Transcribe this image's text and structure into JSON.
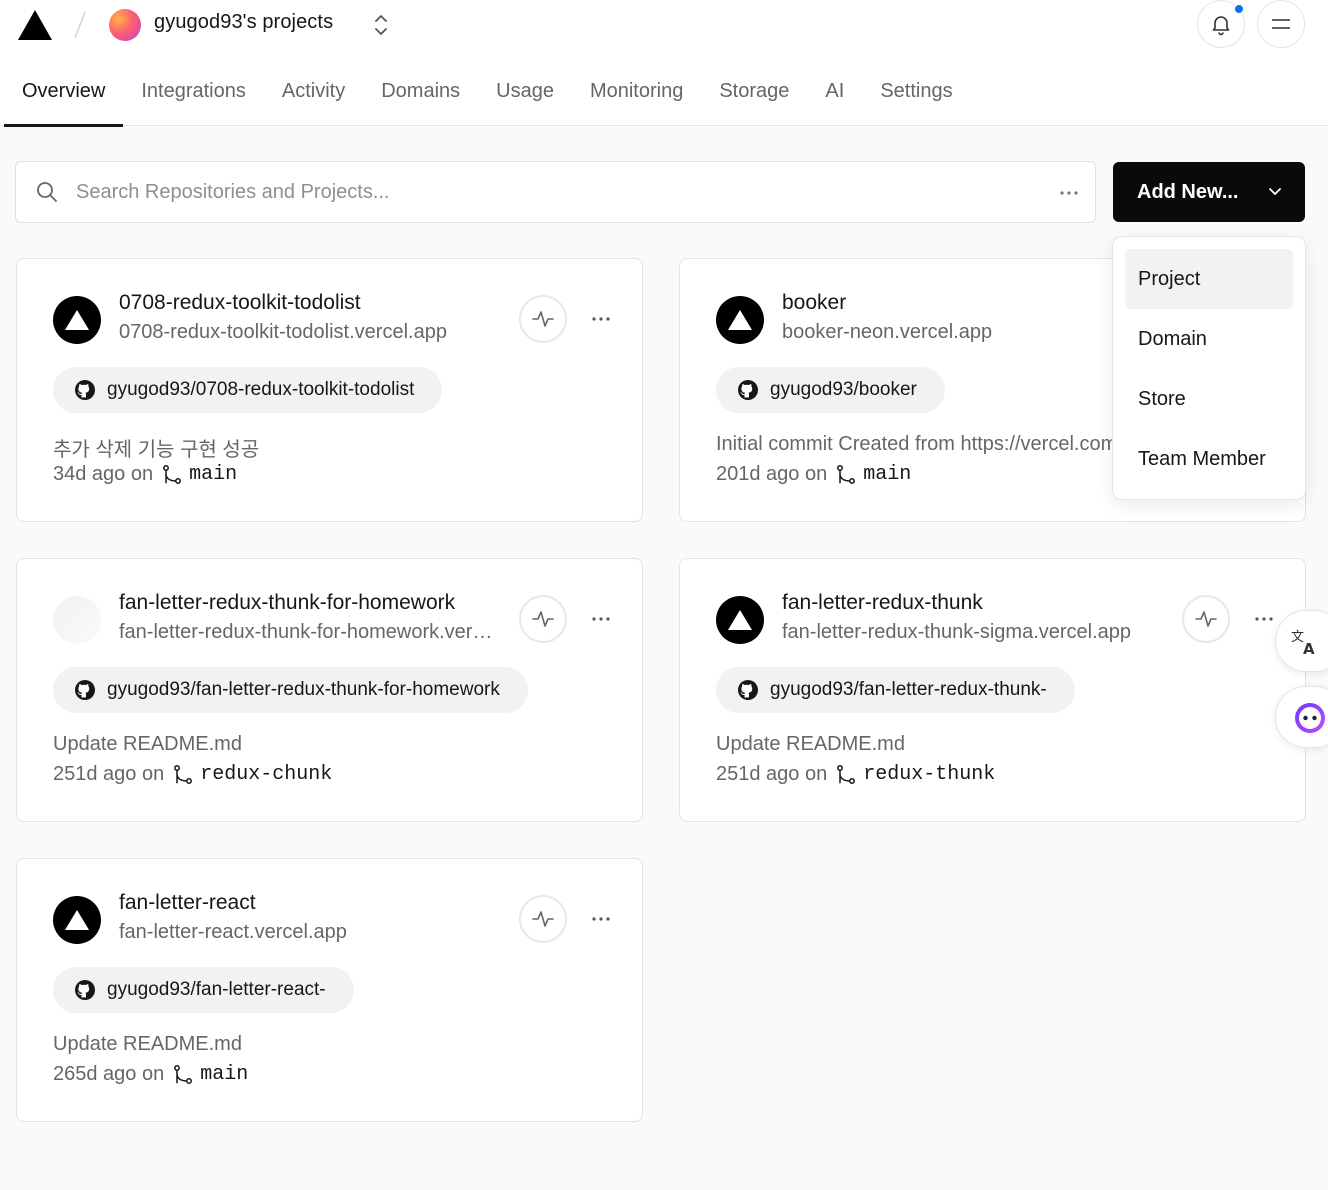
{
  "header": {
    "team_name": "gyugod93's projects",
    "colors": {
      "notification_dot": "#0a72ef",
      "primary_button": "#0a0a0a"
    }
  },
  "tabs": [
    {
      "label": "Overview",
      "active": true
    },
    {
      "label": "Integrations",
      "active": false
    },
    {
      "label": "Activity",
      "active": false
    },
    {
      "label": "Domains",
      "active": false
    },
    {
      "label": "Usage",
      "active": false
    },
    {
      "label": "Monitoring",
      "active": false
    },
    {
      "label": "Storage",
      "active": false
    },
    {
      "label": "AI",
      "active": false
    },
    {
      "label": "Settings",
      "active": false
    }
  ],
  "search": {
    "placeholder": "Search Repositories and Projects...",
    "value": ""
  },
  "add_new": {
    "label": "Add New...",
    "menu": [
      "Project",
      "Domain",
      "Store",
      "Team Member"
    ],
    "highlighted": "Project"
  },
  "projects": [
    {
      "name": "0708-redux-toolkit-todolist",
      "url": "0708-redux-toolkit-todolist.vercel.app",
      "repo": "gyugod93/0708-redux-toolkit-todolist",
      "commit": "추가 삭제 기능 구현 성공",
      "age": "34d ago on",
      "branch": "main",
      "avatar": "vercel-triangle"
    },
    {
      "name": "booker",
      "url": "booker-neon.vercel.app",
      "repo": "gyugod93/booker",
      "commit": "Initial commit Created from https://vercel.com/new",
      "age": "201d ago on",
      "branch": "main",
      "avatar": "vercel-triangle"
    },
    {
      "name": "fan-letter-redux-thunk-for-homework",
      "url": "fan-letter-redux-thunk-for-homework.vercel.app",
      "repo": "gyugod93/fan-letter-redux-thunk-for-homework",
      "commit": "Update README.md",
      "age": "251d ago on",
      "branch": "redux-chunk",
      "avatar": "blank"
    },
    {
      "name": "fan-letter-redux-thunk",
      "url": "fan-letter-redux-thunk-sigma.vercel.app",
      "repo": "gyugod93/fan-letter-redux-thunk-",
      "commit": "Update README.md",
      "age": "251d ago on",
      "branch": "redux-thunk",
      "avatar": "vercel-triangle"
    },
    {
      "name": "fan-letter-react",
      "url": "fan-letter-react.vercel.app",
      "repo": "gyugod93/fan-letter-react-",
      "commit": "Update README.md",
      "age": "265d ago on",
      "branch": "main",
      "avatar": "vercel-triangle"
    }
  ],
  "icons": {
    "logo": "vercel-logo-icon",
    "bell": "bell-icon",
    "menu": "hamburger-icon",
    "activity": "activity-pulse-icon",
    "more": "ellipsis-icon",
    "repo": "github-icon",
    "branch": "git-branch-icon",
    "translate": "translate-icon",
    "assistant": "assistant-icon"
  }
}
